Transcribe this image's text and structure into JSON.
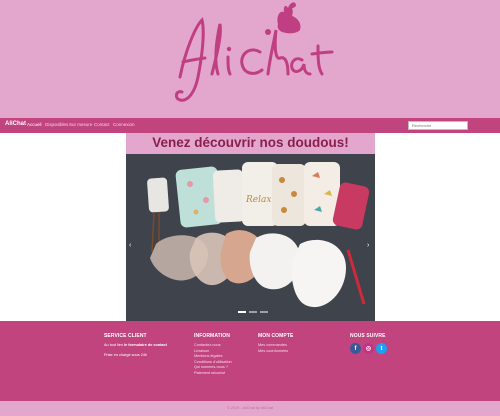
{
  "logo": {
    "text": "AliChat"
  },
  "nav": {
    "brand": "AliChat",
    "links": [
      "Accueil",
      "Disponibles",
      "Sur mesure",
      "Contact",
      "Connexion"
    ],
    "search_placeholder": "Recherche"
  },
  "hero": {
    "title": "Venez découvrir nos doudous!",
    "prev_arrow": "‹",
    "next_arrow": "›"
  },
  "footer": {
    "service": {
      "heading": "SERVICE CLIENT",
      "line1_prefix": "Au tout lien",
      "line1_bold": "le formulaire de contact",
      "line2": "Prise en charge sous 24h"
    },
    "information": {
      "heading": "INFORMATION",
      "links": [
        "Contactez-nous",
        "Livraison",
        "Mentions légales",
        "Conditions d'utilisation",
        "Qui sommes-nous ?",
        "Paiement sécurisé"
      ]
    },
    "account": {
      "heading": "MON COMPTE",
      "links": [
        "Mes commandes",
        "Mes coordonnées"
      ]
    },
    "follow": {
      "heading": "NOUS SUIVRE",
      "icons": [
        "facebook-icon",
        "instagram-icon",
        "twitter-icon"
      ],
      "glyphs": [
        "f",
        "◎",
        "t"
      ]
    }
  },
  "copyright": "© 2019 - AliChat by AliChat",
  "colors": {
    "pink_light": "#e3a7cd",
    "magenta": "#c1447f",
    "title": "#8a1f4d",
    "logo": "#bf3f82"
  }
}
